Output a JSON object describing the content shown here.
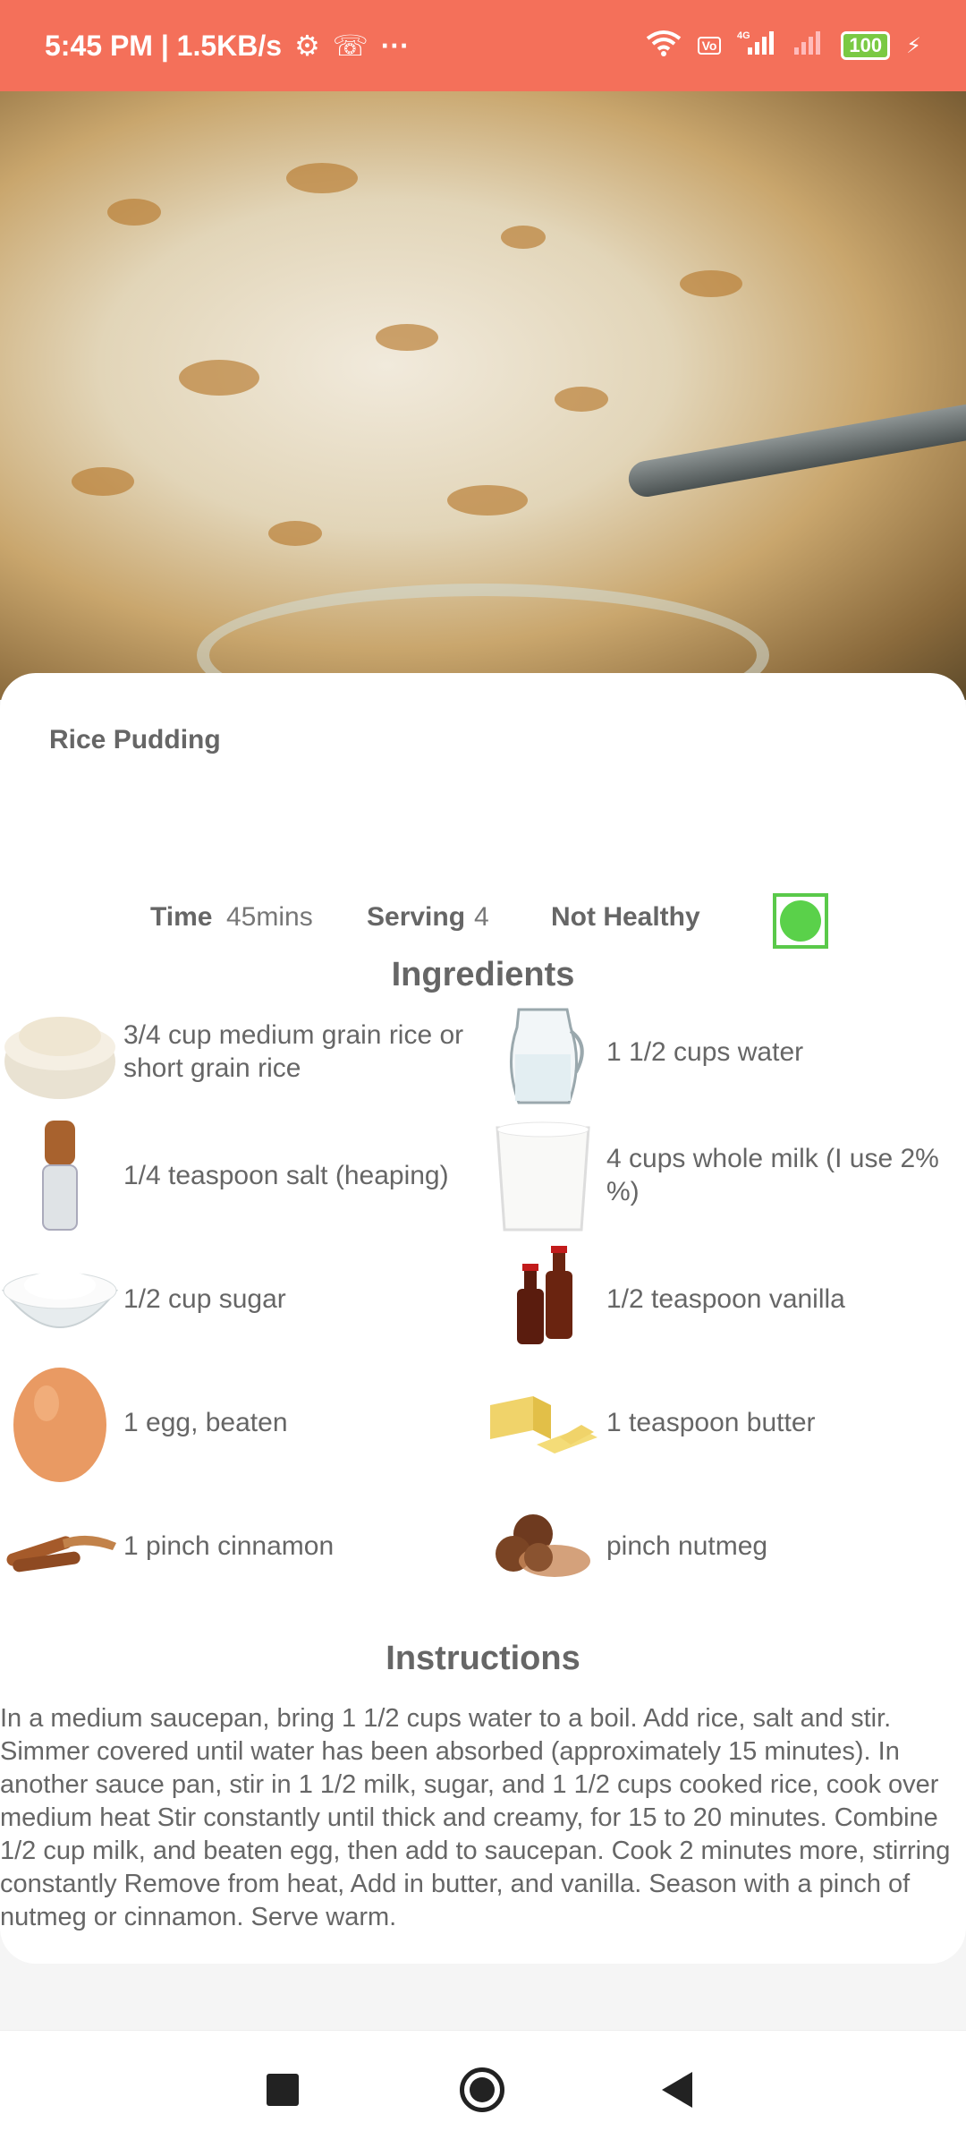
{
  "status_bar": {
    "time_speed": "5:45 PM | 1.5KB/s",
    "more": "···",
    "battery": "100",
    "network_label": "4G"
  },
  "recipe": {
    "title": "Rice Pudding",
    "time_label": "Time",
    "time_value": "45mins",
    "serving_label": "Serving",
    "serving_value": "4",
    "health_label": "Not Healthy",
    "health_indicator_color": "#5ad14a"
  },
  "ingredients_title": "Ingredients",
  "ingredients": [
    {
      "text": "3/4 cup medium grain rice or short grain rice",
      "icon": "rice-bowl-icon"
    },
    {
      "text": "1 1/2 cups water",
      "icon": "water-jug-icon"
    },
    {
      "text": "1/4 teaspoon salt (heaping)",
      "icon": "salt-shaker-icon"
    },
    {
      "text": "4 cups whole milk (I use 2% %)",
      "icon": "milk-glass-icon"
    },
    {
      "text": "1/2 cup sugar",
      "icon": "sugar-bowl-icon"
    },
    {
      "text": "1/2 teaspoon vanilla",
      "icon": "vanilla-bottles-icon"
    },
    {
      "text": "1 egg, beaten",
      "icon": "egg-icon"
    },
    {
      "text": "1 teaspoon butter",
      "icon": "butter-icon"
    },
    {
      "text": "1 pinch cinnamon",
      "icon": "cinnamon-sticks-icon"
    },
    {
      "text": "pinch nutmeg",
      "icon": "nutmeg-icon"
    }
  ],
  "instructions_title": "Instructions",
  "instructions": "In a medium saucepan, bring 1 1/2 cups water to a boil. Add rice, salt and stir. Simmer covered until water has been absorbed (approximately 15 minutes). In another sauce pan, stir in 1 1/2 milk, sugar, and 1 1/2 cups cooked rice, cook over medium heat Stir constantly until thick and creamy, for 15 to 20 minutes. Combine 1/2 cup milk, and beaten egg, then add to saucepan. Cook 2 minutes more, stirring constantly Remove from heat, Add in butter, and vanilla. Season with a pinch of nutmeg or cinnamon. Serve warm.",
  "colors": {
    "status_bar": "#f4705a",
    "card": "#ffffff",
    "text": "#666666"
  }
}
